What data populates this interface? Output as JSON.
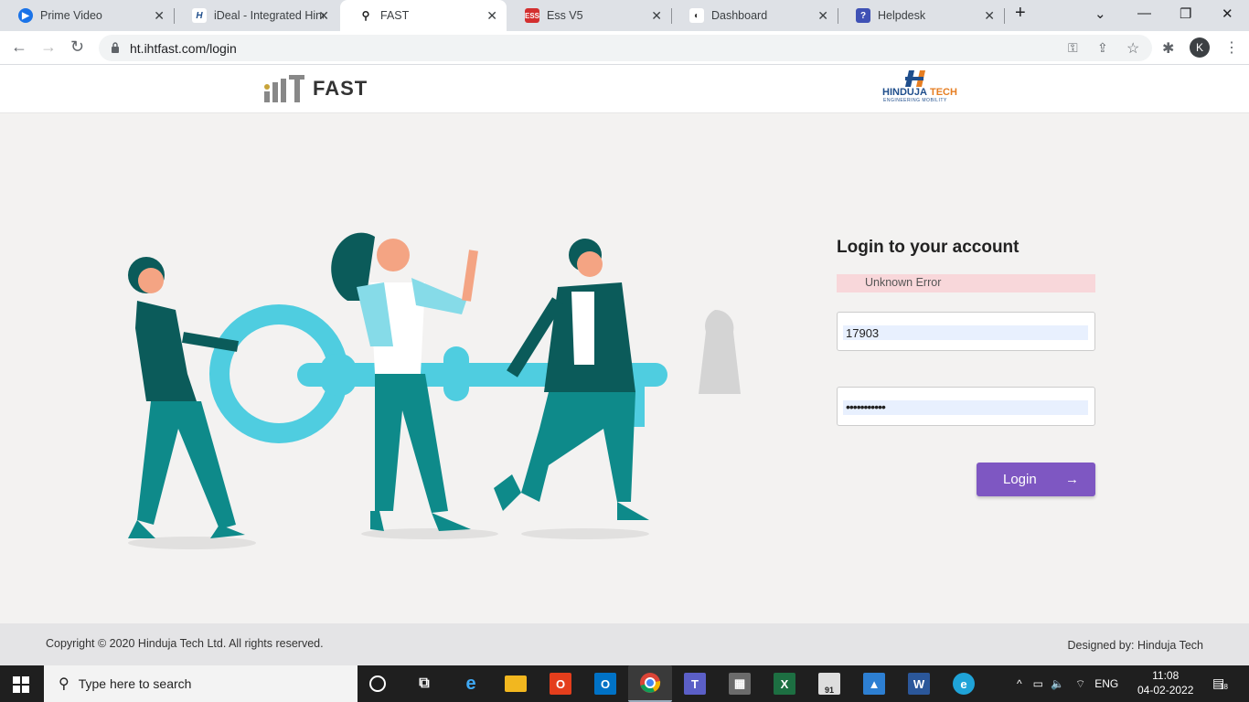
{
  "browser": {
    "tabs": [
      {
        "title": "Prime Video",
        "icon": "prime-video-icon",
        "color": "#1a73e8"
      },
      {
        "title": "iDeal - Integrated Hind",
        "icon": "hinduja-icon",
        "color": "#ffffff"
      },
      {
        "title": "FAST",
        "icon": "fast-icon",
        "color": "#ffffff",
        "active": true
      },
      {
        "title": "Ess V5",
        "icon": "ess-icon",
        "color": "#d32f2f"
      },
      {
        "title": "Dashboard",
        "icon": "dashboard-icon",
        "color": "#ffffff"
      },
      {
        "title": "Helpdesk",
        "icon": "helpdesk-icon",
        "color": "#3f51b5"
      }
    ],
    "url": "ht.ihtfast.com/login",
    "profile_initial": "K"
  },
  "header": {
    "brand": "FAST",
    "partner_name_a": "HINDUJA",
    "partner_name_b": "TECH",
    "partner_tagline": "ENGINEERING MOBILITY"
  },
  "login": {
    "title": "Login to your account",
    "error": "Unknown Error",
    "username": "17903",
    "password_mask": "•••••••••••",
    "button_label": "Login",
    "button_arrow": "→"
  },
  "footer": {
    "copyright": "Copyright © 2020 Hinduja Tech Ltd. All rights reserved.",
    "designed_by": "Designed by: Hinduja Tech"
  },
  "taskbar": {
    "search_placeholder": "Type here to search",
    "language": "ENG",
    "time": "11:08",
    "date": "04-02-2022",
    "notification_count": "18",
    "badge_count": "91"
  },
  "colors": {
    "accent": "#7e57c2",
    "error_bg": "#f8d7da",
    "illustration_teal": "#0e8a8a",
    "illustration_cyan": "#4fcde0"
  }
}
